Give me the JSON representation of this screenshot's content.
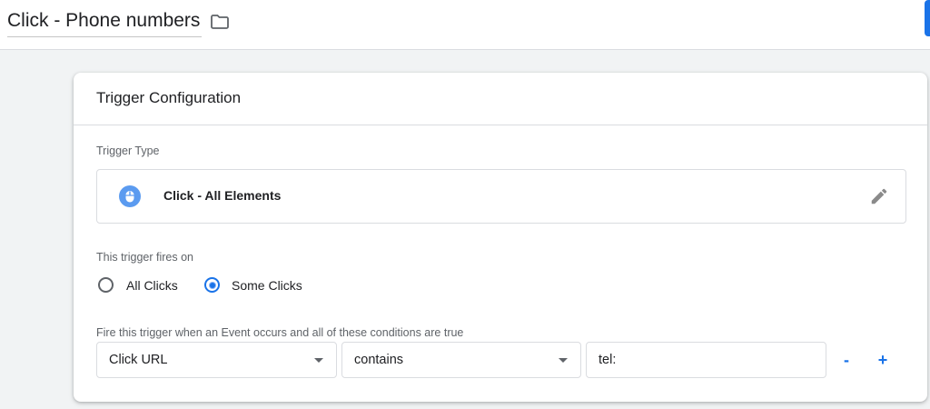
{
  "header": {
    "title": "Click - Phone numbers",
    "folder_icon": "folder-icon"
  },
  "card": {
    "title": "Trigger Configuration",
    "trigger_type_label": "Trigger Type",
    "trigger_type": {
      "icon": "mouse-icon",
      "name": "Click - All Elements",
      "edit_icon": "pencil-icon"
    },
    "fires_on_label": "This trigger fires on",
    "fires_on_options": [
      {
        "label": "All Clicks",
        "selected": false
      },
      {
        "label": "Some Clicks",
        "selected": true
      }
    ],
    "conditions_label": "Fire this trigger when an Event occurs and all of these conditions are true",
    "condition": {
      "variable": "Click URL",
      "operator": "contains",
      "value": "tel:",
      "remove_label": "-",
      "add_label": "+"
    }
  },
  "colors": {
    "accent": "#1a73e8",
    "background": "#f1f3f4",
    "border": "#dadce0"
  }
}
